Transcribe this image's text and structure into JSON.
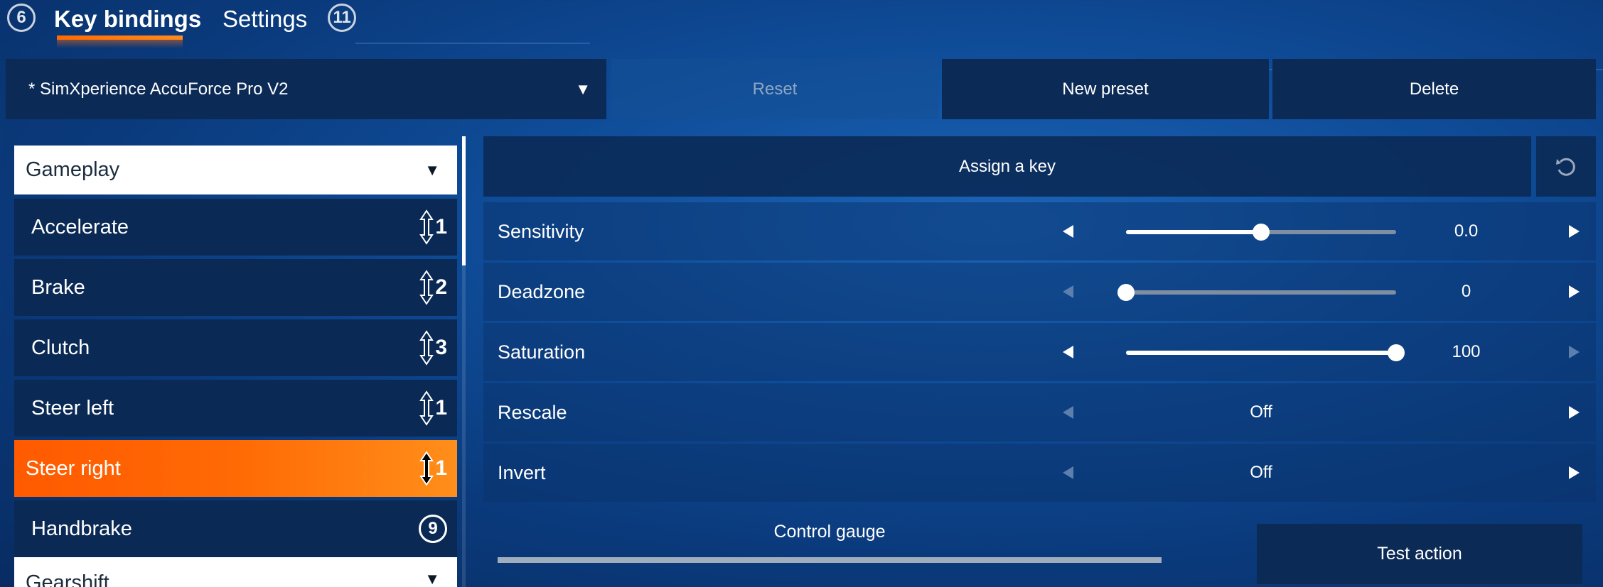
{
  "tabs": {
    "left_badge": "6",
    "key_bindings": "Key bindings",
    "settings": "Settings",
    "right_badge": "11"
  },
  "preset": {
    "selected": "* SimXperience AccuForce Pro V2",
    "reset_label": "Reset",
    "new_preset_label": "New preset",
    "delete_label": "Delete"
  },
  "categories": {
    "gameplay": "Gameplay",
    "gearshift": "Gearshift"
  },
  "bindings": [
    {
      "label": "Accelerate",
      "badge": "1",
      "type": "axis"
    },
    {
      "label": "Brake",
      "badge": "2",
      "type": "axis"
    },
    {
      "label": "Clutch",
      "badge": "3",
      "type": "axis"
    },
    {
      "label": "Steer left",
      "badge": "1",
      "type": "axis"
    },
    {
      "label": "Steer right",
      "badge": "1",
      "type": "axis",
      "selected": true
    },
    {
      "label": "Handbrake",
      "badge": "9",
      "type": "button"
    }
  ],
  "assign": {
    "label": "Assign a key"
  },
  "settings": [
    {
      "label": "Sensitivity",
      "value": "0.0",
      "slider_fraction": 0.5
    },
    {
      "label": "Deadzone",
      "value": "0",
      "slider_fraction": 0.0
    },
    {
      "label": "Saturation",
      "value": "100",
      "slider_fraction": 1.0
    },
    {
      "label": "Rescale",
      "value": "Off"
    },
    {
      "label": "Invert",
      "value": "Off"
    }
  ],
  "gauge": {
    "label": "Control gauge",
    "level": 0.0
  },
  "test_action_label": "Test action",
  "colors": {
    "accent": "#ff6a00",
    "panel": "#0b2a56",
    "background": "#0f4c98"
  }
}
